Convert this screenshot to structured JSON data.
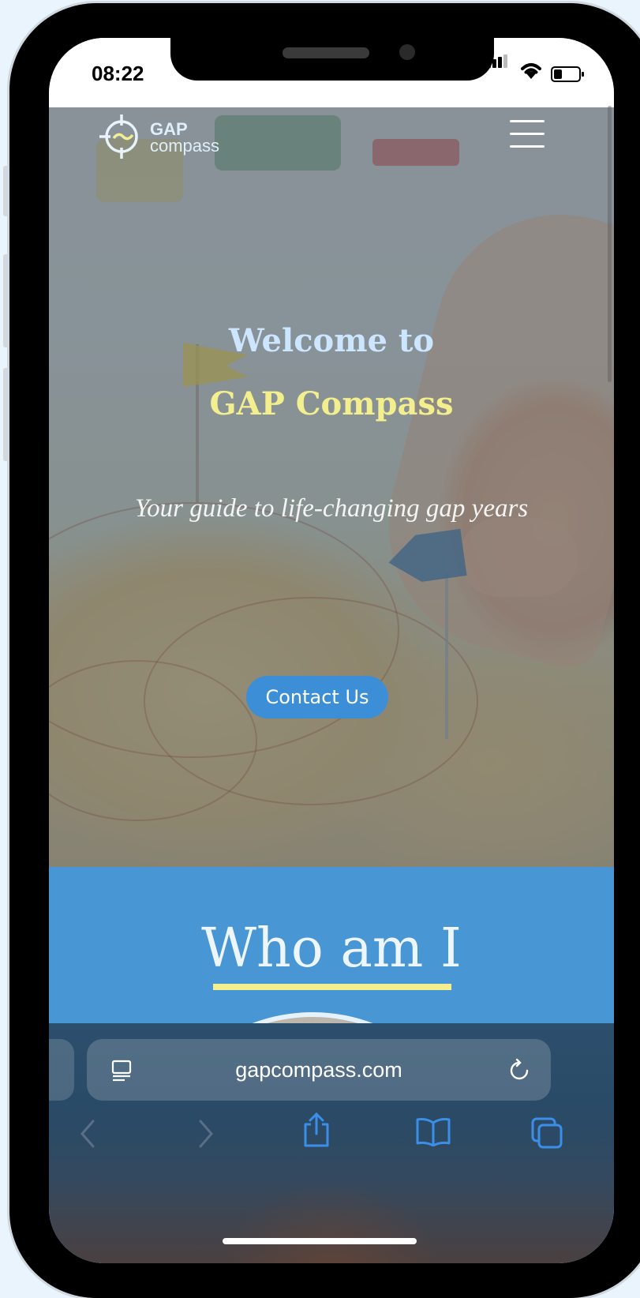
{
  "status_bar": {
    "time": "08:22"
  },
  "nav": {
    "logo_line1": "GAP",
    "logo_line2": "compass"
  },
  "hero": {
    "heading_line1": "Welcome to",
    "heading_line2": "GAP Compass",
    "tagline": "Your guide to life-changing gap years",
    "cta_label": "Contact Us"
  },
  "about": {
    "title": "Who am I"
  },
  "browser": {
    "url": "gapcompass.com"
  },
  "colors": {
    "accent_blue": "#4896d3",
    "accent_yellow": "#f3ee8e",
    "button_blue": "#3c8fd7"
  }
}
